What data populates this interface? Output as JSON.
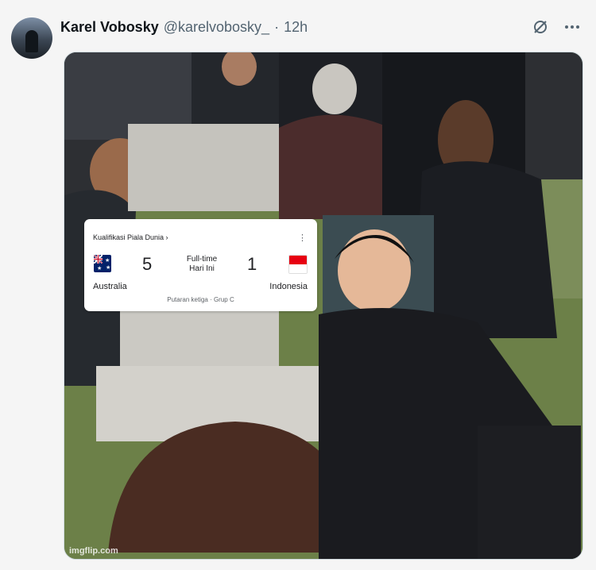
{
  "tweet": {
    "author_name": "Karel Vobosky",
    "handle": "@karelvobosky_",
    "separator": "·",
    "time": "12h",
    "avatar_icon": "profile-avatar"
  },
  "actions": {
    "grok_icon": "slashed-circle-icon",
    "more_icon": "more-horizontal-icon"
  },
  "media": {
    "watermark": "imgflip.com"
  },
  "scorecard": {
    "competition": "Kualifikasi Piala Dunia ›",
    "more_icon": "⋮",
    "home_team": "Australia",
    "home_score": "5",
    "away_team": "Indonesia",
    "away_score": "1",
    "status_line1": "Full-time",
    "status_line2": "Hari Ini",
    "round": "Putaran ketiga · Grup C"
  },
  "colors": {
    "text_primary": "#0f1419",
    "text_secondary": "#536471",
    "background": "#f5f5f5",
    "australia_flag_blue": "#012169",
    "indonesia_flag_red": "#e70011"
  }
}
